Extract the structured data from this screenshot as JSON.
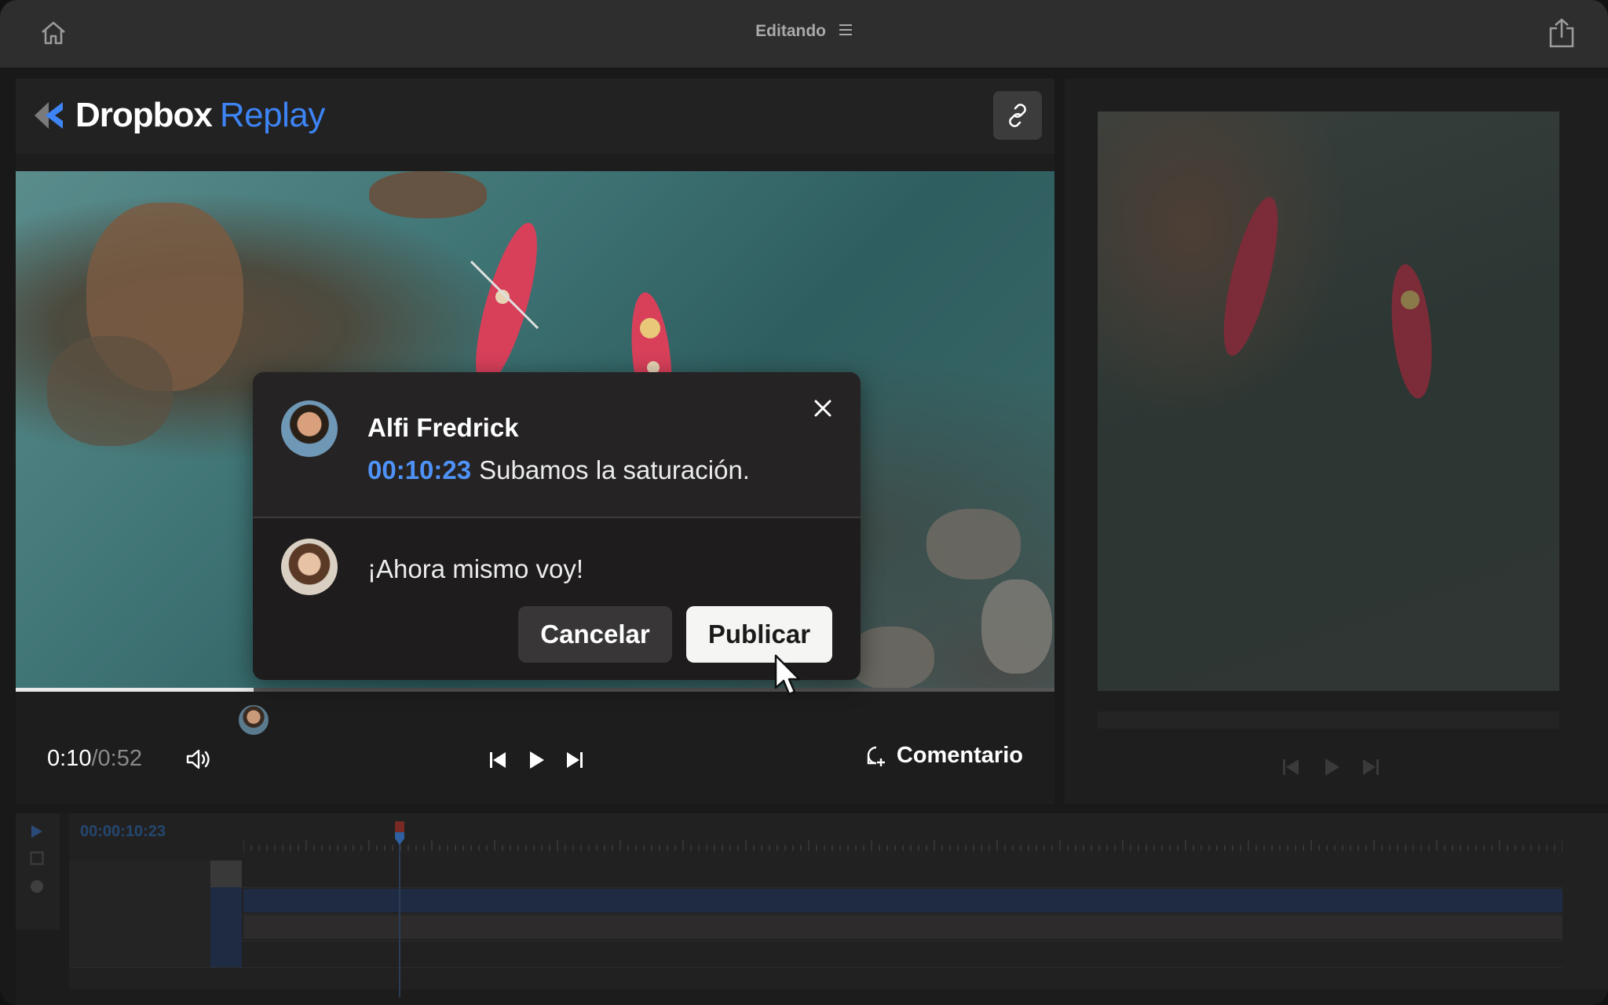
{
  "titlebar": {
    "title": "Editando",
    "home_icon": "home-icon",
    "menu_icon": "menu-icon",
    "share_icon": "share-icon"
  },
  "header": {
    "logo_brand": "Dropbox",
    "logo_product": "Replay",
    "link_icon": "link-icon"
  },
  "player": {
    "time_current": "0:10",
    "time_separator": "/",
    "time_total": "0:52",
    "progress_fraction": 0.2288,
    "comment_label": "Comentario"
  },
  "comment_popup": {
    "author": "Alfi Fredrick",
    "timestamp": "00:10:23",
    "comment": "Subamos la saturación.",
    "reply": "¡Ahora mismo voy!",
    "cancel_label": "Cancelar",
    "publish_label": "Publicar"
  },
  "timeline": {
    "timecode": "00:00:10:23"
  },
  "colors": {
    "accent_blue": "#3d84f5",
    "timestamp_blue": "#4f92f7",
    "track_blue": "#1f2b42"
  }
}
